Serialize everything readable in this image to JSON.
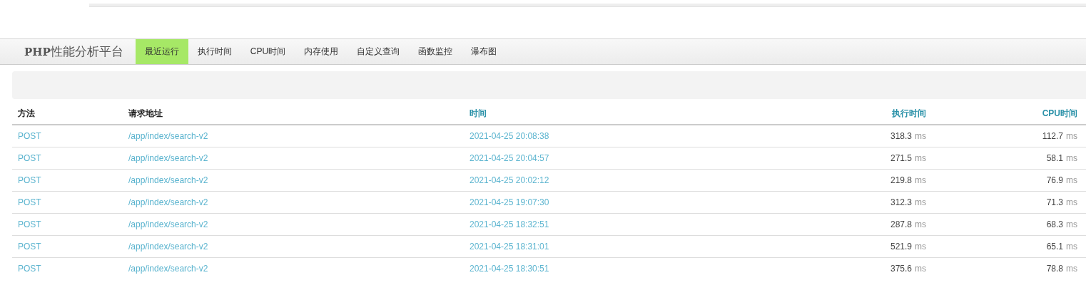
{
  "navbar": {
    "brand": "**PHP**性能分析平台",
    "items": [
      {
        "label": "最近运行",
        "selected": true
      },
      {
        "label": "执行时间",
        "selected": false
      },
      {
        "label": "CPU时间",
        "selected": false
      },
      {
        "label": "内存使用",
        "selected": false
      },
      {
        "label": "自定义查询",
        "selected": false
      },
      {
        "label": "函数监控",
        "selected": false
      },
      {
        "label": "瀑布图",
        "selected": false
      }
    ]
  },
  "table": {
    "columns": [
      {
        "label": "方法",
        "sortable": false,
        "kind": "text"
      },
      {
        "label": "请求地址",
        "sortable": false,
        "kind": "text"
      },
      {
        "label": "时间",
        "sortable": true,
        "kind": "text"
      },
      {
        "label": "执行时间",
        "sortable": true,
        "kind": "number"
      },
      {
        "label": "CPU时间",
        "sortable": true,
        "kind": "number"
      }
    ],
    "rows": [
      {
        "method": "POST",
        "url": "/app/index/search-v2",
        "time": "2021-04-25 20:08:38",
        "wall": {
          "value": "318.3",
          "unit": "ms"
        },
        "cpu": {
          "value": "112.7",
          "unit": "ms"
        }
      },
      {
        "method": "POST",
        "url": "/app/index/search-v2",
        "time": "2021-04-25 20:04:57",
        "wall": {
          "value": "271.5",
          "unit": "ms"
        },
        "cpu": {
          "value": "58.1",
          "unit": "ms"
        }
      },
      {
        "method": "POST",
        "url": "/app/index/search-v2",
        "time": "2021-04-25 20:02:12",
        "wall": {
          "value": "219.8",
          "unit": "ms"
        },
        "cpu": {
          "value": "76.9",
          "unit": "ms"
        }
      },
      {
        "method": "POST",
        "url": "/app/index/search-v2",
        "time": "2021-04-25 19:07:30",
        "wall": {
          "value": "312.3",
          "unit": "ms"
        },
        "cpu": {
          "value": "71.3",
          "unit": "ms"
        }
      },
      {
        "method": "POST",
        "url": "/app/index/search-v2",
        "time": "2021-04-25 18:32:51",
        "wall": {
          "value": "287.8",
          "unit": "ms"
        },
        "cpu": {
          "value": "68.3",
          "unit": "ms"
        }
      },
      {
        "method": "POST",
        "url": "/app/index/search-v2",
        "time": "2021-04-25 18:31:01",
        "wall": {
          "value": "521.9",
          "unit": "ms"
        },
        "cpu": {
          "value": "65.1",
          "unit": "ms"
        }
      },
      {
        "method": "POST",
        "url": "/app/index/search-v2",
        "time": "2021-04-25 18:30:51",
        "wall": {
          "value": "375.6",
          "unit": "ms"
        },
        "cpu": {
          "value": "78.8",
          "unit": "ms"
        }
      }
    ]
  }
}
